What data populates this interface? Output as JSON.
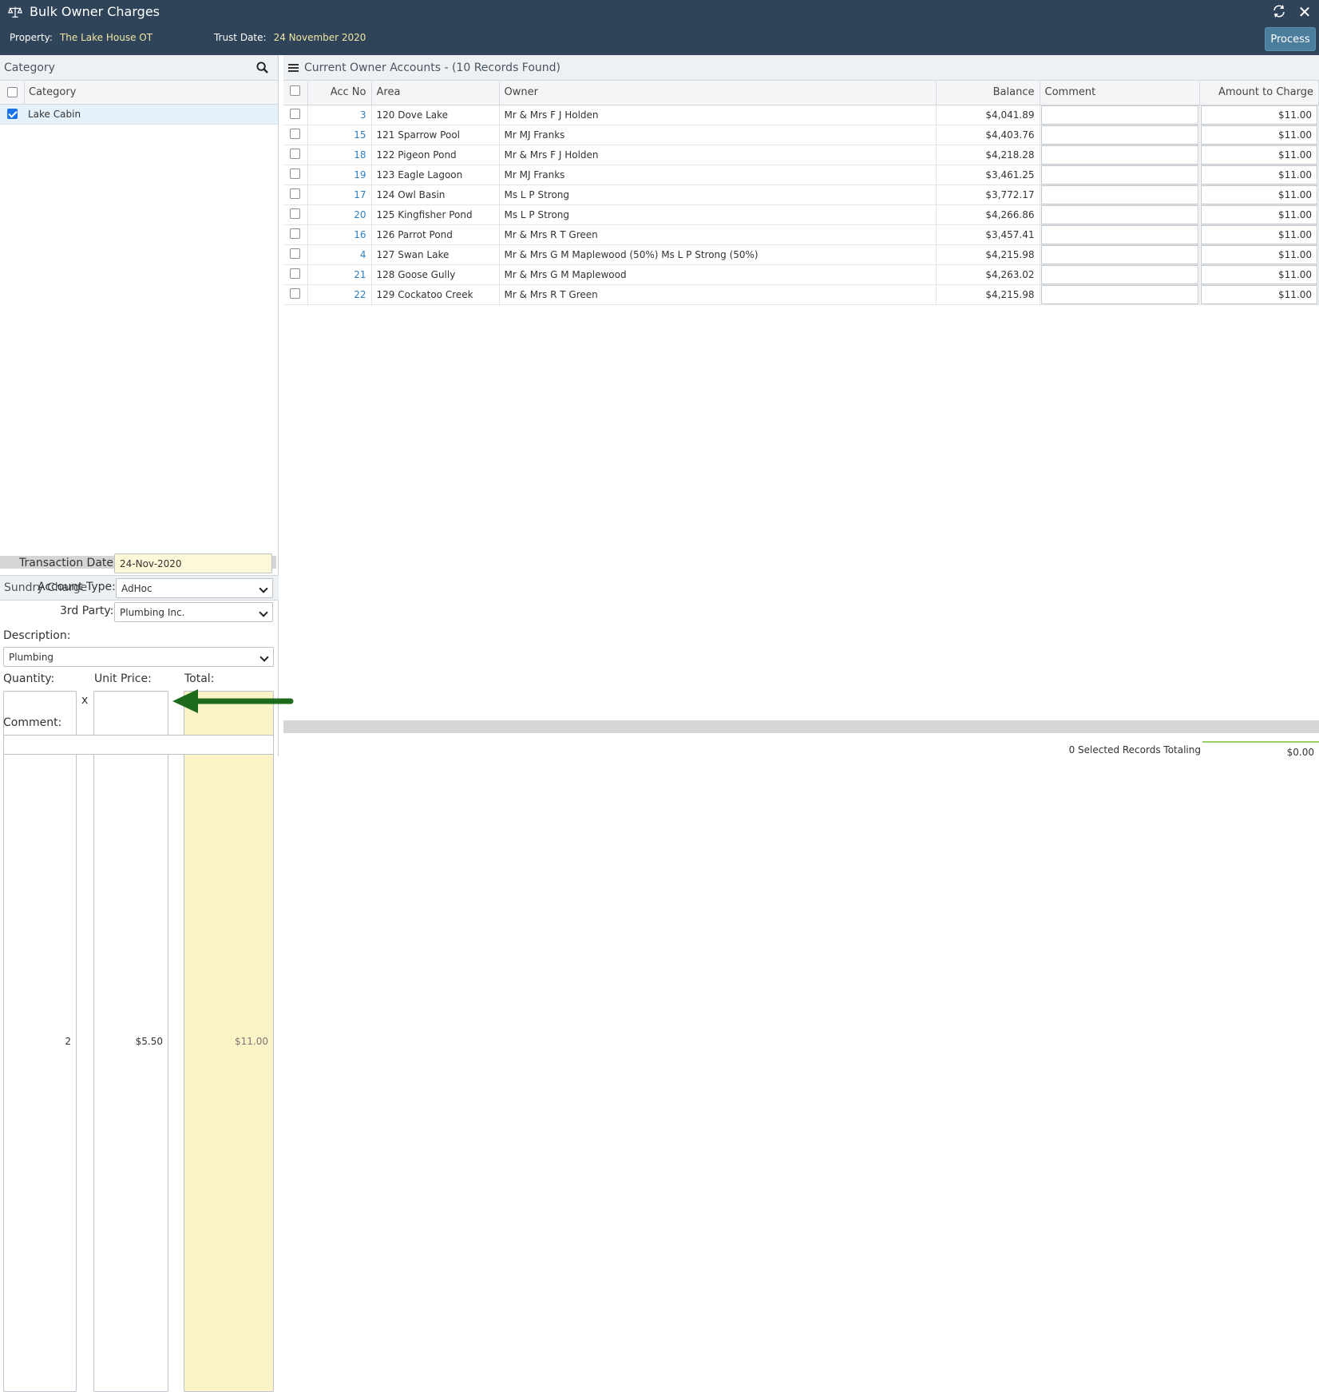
{
  "window": {
    "title": "Bulk Owner Charges",
    "process_label": "Process"
  },
  "info": {
    "property_label": "Property:",
    "property_value": "The Lake House OT",
    "trust_label": "Trust Date:",
    "trust_value": "24 November 2020"
  },
  "category": {
    "title": "Category",
    "column": "Category",
    "rows": [
      {
        "label": "Lake Cabin",
        "checked": true
      }
    ]
  },
  "sundry": {
    "title": "Sundry Charge",
    "transaction_date_label": "Transaction Date:",
    "transaction_date": "24-Nov-2020",
    "account_type_label": "Account Type:",
    "account_type": "AdHoc",
    "third_party_label": "3rd Party:",
    "third_party": "Plumbing Inc.",
    "description_label": "Description:",
    "description": "Plumbing",
    "quantity_label": "Quantity:",
    "quantity": "2",
    "unit_price_label": "Unit Price:",
    "unit_price": "$5.50",
    "times": "x",
    "total_label": "Total:",
    "total": "$11.00",
    "comment_label": "Comment:",
    "comment": ""
  },
  "accounts": {
    "title": "Current Owner Accounts - (10 Records Found)",
    "columns": {
      "acc": "Acc No",
      "area": "Area",
      "owner": "Owner",
      "balance": "Balance",
      "comment": "Comment",
      "amount": "Amount to Charge"
    },
    "rows": [
      {
        "acc": "3",
        "area": "120 Dove Lake",
        "owner": "Mr & Mrs F J Holden",
        "balance": "$4,041.89",
        "amount": "$11.00"
      },
      {
        "acc": "15",
        "area": "121 Sparrow Pool",
        "owner": "Mr MJ Franks",
        "balance": "$4,403.76",
        "amount": "$11.00"
      },
      {
        "acc": "18",
        "area": "122 Pigeon Pond",
        "owner": "Mr & Mrs F J Holden",
        "balance": "$4,218.28",
        "amount": "$11.00"
      },
      {
        "acc": "19",
        "area": "123 Eagle Lagoon",
        "owner": "Mr MJ Franks",
        "balance": "$3,461.25",
        "amount": "$11.00"
      },
      {
        "acc": "17",
        "area": "124 Owl Basin",
        "owner": "Ms L P Strong",
        "balance": "$3,772.17",
        "amount": "$11.00"
      },
      {
        "acc": "20",
        "area": "125 Kingfisher Pond",
        "owner": "Ms L P Strong",
        "balance": "$4,266.86",
        "amount": "$11.00"
      },
      {
        "acc": "16",
        "area": "126 Parrot Pond",
        "owner": "Mr & Mrs R T Green",
        "balance": "$3,457.41",
        "amount": "$11.00"
      },
      {
        "acc": "4",
        "area": "127 Swan Lake",
        "owner": "Mr & Mrs G M Maplewood (50%) Ms L P Strong (50%)",
        "balance": "$4,215.98",
        "amount": "$11.00"
      },
      {
        "acc": "21",
        "area": "128 Goose Gully",
        "owner": "Mr & Mrs G M Maplewood",
        "balance": "$4,263.02",
        "amount": "$11.00"
      },
      {
        "acc": "22",
        "area": "129 Cockatoo Creek",
        "owner": "Mr & Mrs R T Green",
        "balance": "$4,215.98",
        "amount": "$11.00"
      }
    ],
    "footer_label": "0 Selected Records Totaling",
    "footer_total": "$0.00"
  },
  "icons": {
    "app": "scales-icon",
    "refresh": "refresh-icon",
    "close": "close-icon",
    "search": "search-icon",
    "menu": "menu-icon",
    "annotation": "arrow-left-icon"
  },
  "colors": {
    "header": "#2f4359",
    "accent_text": "#f2e7a4",
    "link": "#2e7fc0",
    "arrow": "#1e6b1e"
  }
}
